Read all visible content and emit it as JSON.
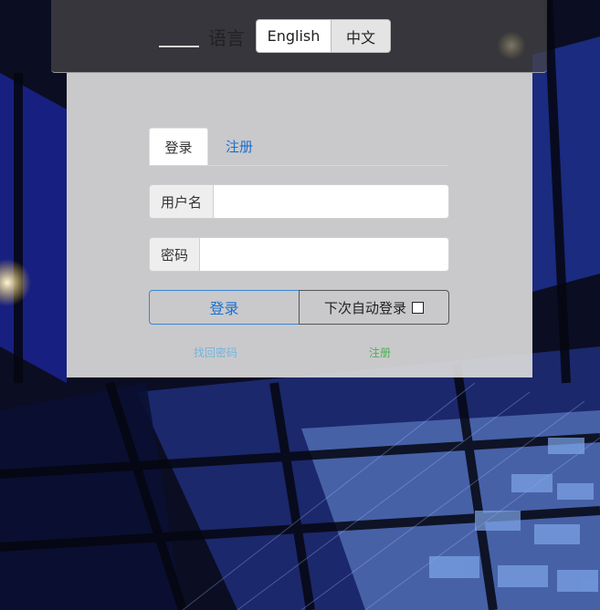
{
  "language_bar": {
    "label": "语言",
    "options": [
      "English",
      "中文"
    ]
  },
  "tabs": {
    "login": "登录",
    "register": "注册"
  },
  "form": {
    "username_label": "用户名",
    "username_value": "",
    "password_label": "密码",
    "password_value": "",
    "login_button": "登录",
    "remember_label": "下次自动登录",
    "remember_checked": false
  },
  "links": {
    "forgot_password": "找回密码",
    "register": "注册"
  },
  "colors": {
    "link_blue": "#1a6fd0",
    "forgot_link": "#6fb6e0",
    "register_link": "#4caf50"
  }
}
